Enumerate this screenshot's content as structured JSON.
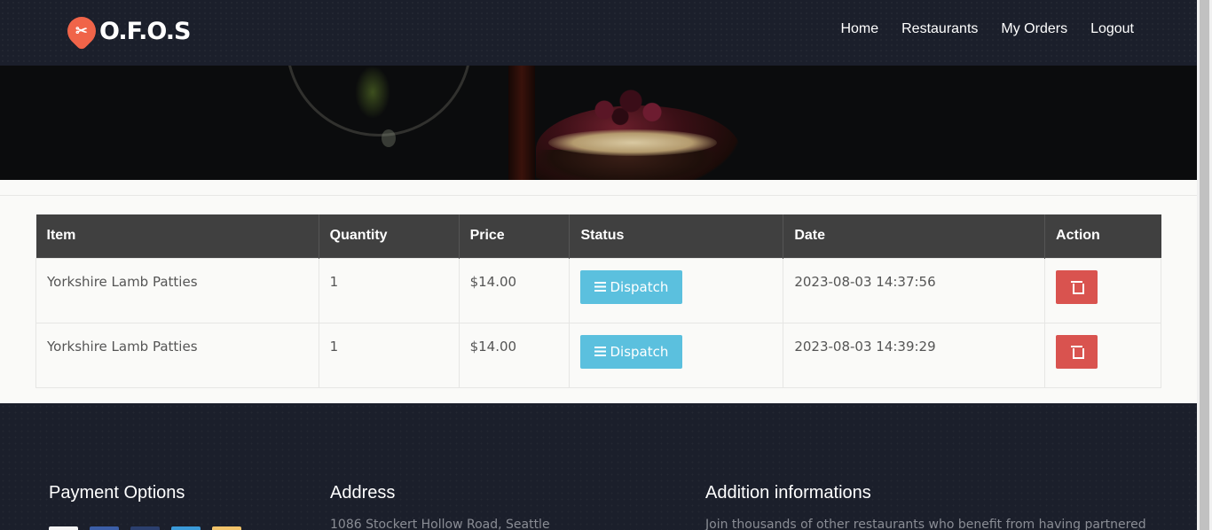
{
  "header": {
    "logo_text": "O.F.O.S",
    "nav": [
      "Home",
      "Restaurants",
      "My Orders",
      "Logout"
    ]
  },
  "table": {
    "columns": [
      "Item",
      "Quantity",
      "Price",
      "Status",
      "Date",
      "Action"
    ],
    "rows": [
      {
        "item": "Yorkshire Lamb Patties",
        "quantity": "1",
        "price": "$14.00",
        "status": "Dispatch",
        "date": "2023-08-03 14:37:56"
      },
      {
        "item": "Yorkshire Lamb Patties",
        "quantity": "1",
        "price": "$14.00",
        "status": "Dispatch",
        "date": "2023-08-03 14:39:29"
      }
    ]
  },
  "footer": {
    "payment_title": "Payment Options",
    "address_title": "Address",
    "address_text": "1086 Stockert Hollow Road, Seattle",
    "info_title": "Addition informations",
    "info_text": "Join thousands of other restaurants who benefit from having partnered"
  },
  "colors": {
    "nav_bg": "#1b1f2b",
    "brand": "#f06449",
    "dispatch": "#5bc0de",
    "delete": "#d9534f",
    "table_header": "#404040"
  }
}
